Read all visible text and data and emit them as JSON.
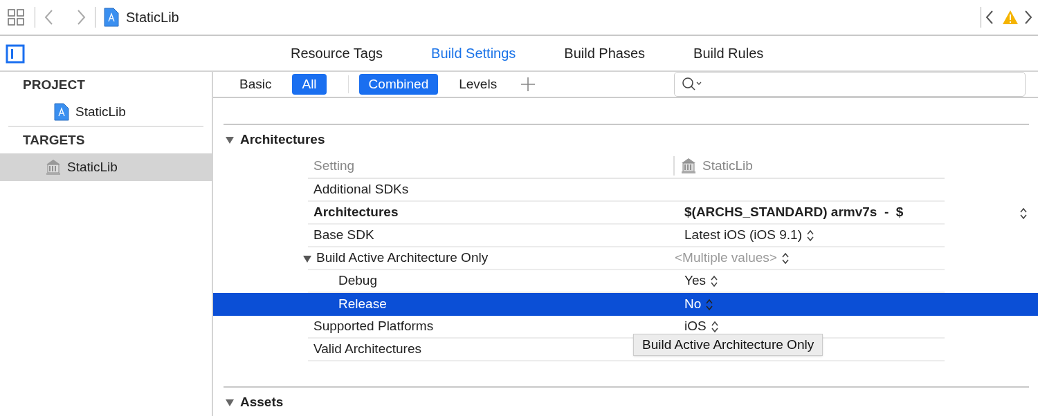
{
  "toolbar": {
    "title": "StaticLib"
  },
  "editor_tabs": [
    {
      "label": "Resource Tags",
      "selected": false
    },
    {
      "label": "Build Settings",
      "selected": true
    },
    {
      "label": "Build Phases",
      "selected": false
    },
    {
      "label": "Build Rules",
      "selected": false
    }
  ],
  "sidebar": {
    "sections": [
      {
        "heading": "PROJECT",
        "items": [
          {
            "label": "StaticLib",
            "kind": "project",
            "selected": false
          }
        ]
      },
      {
        "heading": "TARGETS",
        "items": [
          {
            "label": "StaticLib",
            "kind": "target",
            "selected": true
          }
        ]
      }
    ]
  },
  "filter_groups": [
    [
      {
        "label": "Basic",
        "selected": false
      },
      {
        "label": "All",
        "selected": true
      }
    ],
    [
      {
        "label": "Combined",
        "selected": true
      },
      {
        "label": "Levels",
        "selected": false
      }
    ]
  ],
  "sections": [
    {
      "title": "Architectures",
      "expanded": true,
      "columns": [
        "Setting",
        "StaticLib"
      ],
      "rows": [
        {
          "name": "Additional SDKs",
          "kind": "text",
          "bold": false,
          "selected": false
        },
        {
          "name": "Architectures",
          "value": "$(ARCHS_STANDARD) armv7s  -  $",
          "kind": "list",
          "bold": true,
          "dimmed": false,
          "selected": false
        },
        {
          "name": "Base SDK",
          "value": "Latest iOS (iOS 9.1)",
          "kind": "popup",
          "bold": false,
          "dimmed": false,
          "selected": false
        },
        {
          "name": "Build Active Architecture Only",
          "value": "<Multiple values>",
          "kind": "popup",
          "bold": false,
          "dimmed": true,
          "selected": false,
          "expanded": true,
          "children": [
            {
              "name": "Debug",
              "value": "Yes",
              "kind": "popup",
              "bold": false,
              "dimmed": false,
              "selected": false
            },
            {
              "name": "Release",
              "value": "No",
              "kind": "popup",
              "bold": false,
              "dimmed": false,
              "selected": true
            }
          ]
        },
        {
          "name": "Supported Platforms",
          "value": "iOS",
          "kind": "popup",
          "bold": false,
          "dimmed": false,
          "selected": false
        },
        {
          "name": "Valid Architectures",
          "kind": "text",
          "bold": false,
          "selected": false
        }
      ],
      "tooltip": "Build Active Architecture Only"
    },
    {
      "title": "Assets",
      "expanded": true
    }
  ]
}
